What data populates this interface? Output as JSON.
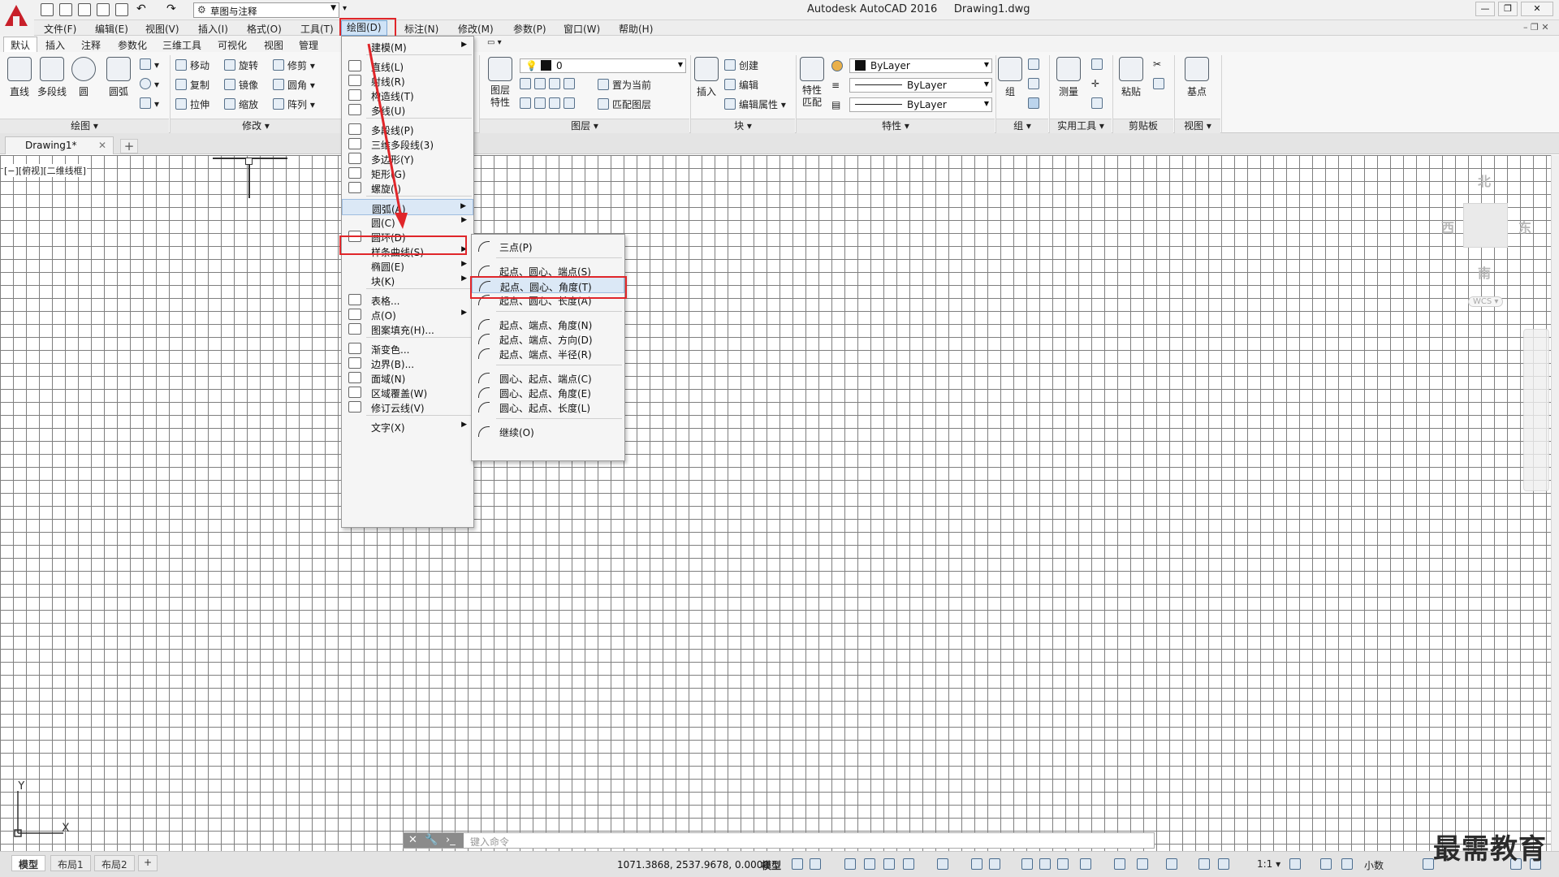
{
  "title_bar": {
    "workspace": "草图与注释",
    "app_title": "Autodesk AutoCAD 2016",
    "file_title": "Drawing1.dwg"
  },
  "menubar": [
    "文件(F)",
    "编辑(E)",
    "视图(V)",
    "插入(I)",
    "格式(O)",
    "工具(T)",
    "绘图(D)",
    "标注(N)",
    "修改(M)",
    "参数(P)",
    "窗口(W)",
    "帮助(H)"
  ],
  "ribbon_tabs": [
    "默认",
    "插入",
    "注释",
    "参数化",
    "三维工具",
    "可视化",
    "视图",
    "管理"
  ],
  "ribbon": {
    "draw": {
      "big": [
        "直线",
        "多段线",
        "圆",
        "圆弧"
      ],
      "title": "绘图 ▾"
    },
    "modify": {
      "tools": [
        "移动",
        "旋转",
        "修剪",
        "复制",
        "镜像",
        "圆角",
        "拉伸",
        "缩放",
        "阵列"
      ],
      "title": "修改 ▾"
    },
    "layers": {
      "layer_name": "0",
      "tools": [
        "置为当前",
        "匹配图层"
      ],
      "big": "图层\n特性",
      "title": "图层 ▾"
    },
    "block": {
      "big": "插入",
      "tools": [
        "创建",
        "编辑",
        "编辑属性"
      ],
      "title": "块 ▾"
    },
    "properties": {
      "big": "特性\n匹配",
      "color": "ByLayer",
      "linetype": "ByLayer",
      "lineweight": "ByLayer",
      "title": "特性 ▾"
    },
    "group": {
      "big": "组",
      "title": "组 ▾"
    },
    "utilities": {
      "big": "测量",
      "title": "实用工具 ▾"
    },
    "clipboard": {
      "big": "粘贴",
      "title": "剪贴板"
    },
    "view": {
      "big": "基点",
      "title": "视图 ▾"
    }
  },
  "file_tab": {
    "name": "Drawing1*",
    "close": "✕",
    "add": "+"
  },
  "viewport_label": "[−][俯视][二维线框]",
  "viewcube": {
    "north": "北",
    "south": "南",
    "west": "西",
    "east": "东",
    "wcs": "WCS ▾"
  },
  "ucs": {
    "x": "X",
    "y": "Y"
  },
  "draw_menu": {
    "items": [
      {
        "label": "建模(M)",
        "arrow": true
      },
      {
        "label": "直线(L)"
      },
      {
        "label": "射线(R)"
      },
      {
        "label": "构造线(T)"
      },
      {
        "label": "多线(U)"
      },
      {
        "label": "多段线(P)"
      },
      {
        "label": "三维多段线(3)"
      },
      {
        "label": "多边形(Y)"
      },
      {
        "label": "矩形(G)"
      },
      {
        "label": "螺旋(I)"
      },
      {
        "label": "圆弧(A)",
        "arrow": true
      },
      {
        "label": "圆(C)",
        "arrow": true
      },
      {
        "label": "圆环(D)"
      },
      {
        "label": "样条曲线(S)",
        "arrow": true
      },
      {
        "label": "椭圆(E)",
        "arrow": true
      },
      {
        "label": "块(K)",
        "arrow": true
      },
      {
        "label": "表格..."
      },
      {
        "label": "点(O)",
        "arrow": true
      },
      {
        "label": "图案填充(H)..."
      },
      {
        "label": "渐变色..."
      },
      {
        "label": "边界(B)..."
      },
      {
        "label": "面域(N)"
      },
      {
        "label": "区域覆盖(W)"
      },
      {
        "label": "修订云线(V)"
      },
      {
        "label": "文字(X)",
        "arrow": true
      }
    ]
  },
  "arc_submenu": {
    "items": [
      "三点(P)",
      "起点、圆心、端点(S)",
      "起点、圆心、角度(T)",
      "起点、圆心、长度(A)",
      "起点、端点、角度(N)",
      "起点、端点、方向(D)",
      "起点、端点、半径(R)",
      "圆心、起点、端点(C)",
      "圆心、起点、角度(E)",
      "圆心、起点、长度(L)",
      "继续(O)"
    ]
  },
  "command_line": {
    "placeholder": "键入命令"
  },
  "layout_tabs": [
    "模型",
    "布局1",
    "布局2"
  ],
  "status_bar": {
    "coords": "1071.3868, 2537.9678, 0.0000",
    "model": "模型",
    "scale": "1:1 ▾",
    "units": "小数"
  },
  "watermark": "最需教育",
  "colors": {
    "accent_red": "#e0262a",
    "menu_highlight": "#dbe8f6",
    "logo_red": "#c8202a"
  }
}
